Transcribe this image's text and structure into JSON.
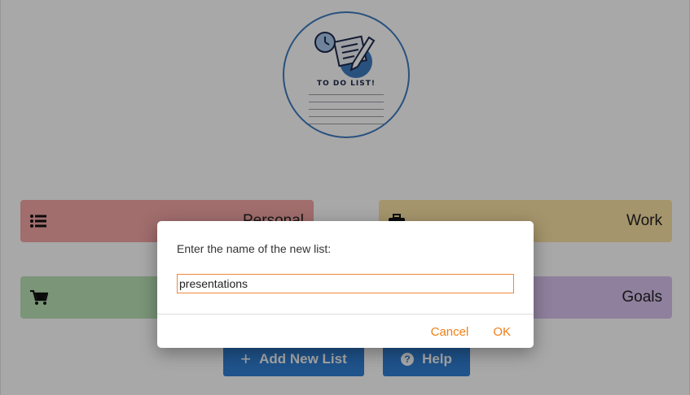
{
  "logo": {
    "title": "TO DO LIST!"
  },
  "cards": {
    "personal": {
      "label": "Personal",
      "icon": "list-icon",
      "color": "#f4a6a6"
    },
    "work": {
      "label": "Work",
      "icon": "briefcase-icon",
      "color": "#fbe3a4"
    },
    "shopping": {
      "label": "",
      "icon": "cart-icon",
      "color": "#b9e3b5"
    },
    "goals": {
      "label": "Goals",
      "icon": "",
      "color": "#d9c2ef"
    }
  },
  "buttons": {
    "add_label": "Add New List",
    "add_icon": "plus-icon",
    "help_label": "Help",
    "help_icon": "question-icon",
    "color": "#2f7fd4"
  },
  "dialog": {
    "message": "Enter the name of the new list:",
    "input_value": "presentations",
    "cancel_label": "Cancel",
    "ok_label": "OK",
    "accent": "#f07f16"
  }
}
